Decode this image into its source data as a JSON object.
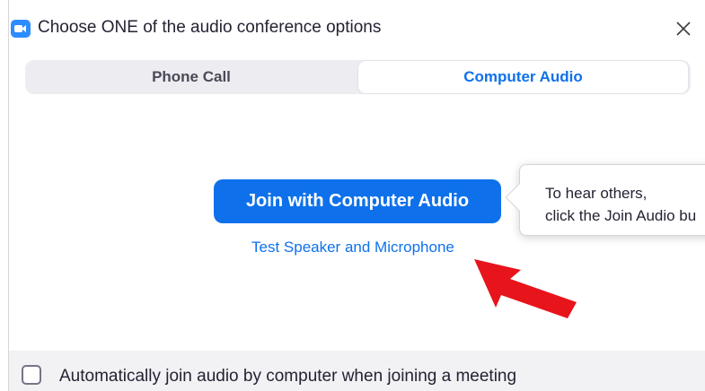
{
  "window": {
    "title": "Choose ONE of the audio conference options",
    "app_icon": "zoom-camera-icon",
    "close_icon": "close-icon"
  },
  "tabs": [
    {
      "label": "Phone Call",
      "selected": false
    },
    {
      "label": "Computer Audio",
      "selected": true
    }
  ],
  "main": {
    "join_button_label": "Join with Computer Audio",
    "test_link_label": "Test Speaker and Microphone",
    "pointer_arrow_icon": "red-arrow-icon"
  },
  "tooltip": {
    "line1": "To hear others,",
    "line2": "click the Join Audio bu"
  },
  "footer": {
    "checkbox_checked": false,
    "checkbox_label": "Automatically join audio by computer when joining a meeting"
  },
  "colors": {
    "accent": "#0e71eb",
    "app_icon": "#2d8cff",
    "arrow": "#e8141c"
  }
}
